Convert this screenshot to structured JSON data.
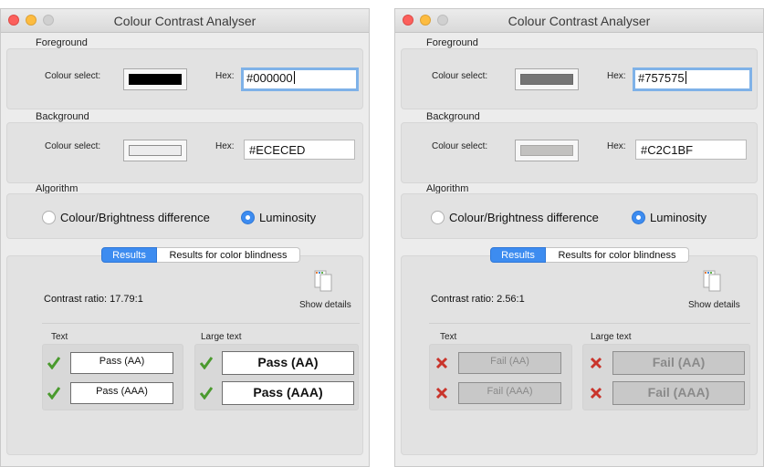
{
  "left": {
    "title": "Colour Contrast Analyser",
    "foreground": {
      "label": "Foreground",
      "colour_select_label": "Colour select:",
      "hex_label": "Hex:",
      "hex_value": "#000000",
      "swatch_color": "#000000"
    },
    "background": {
      "label": "Background",
      "colour_select_label": "Colour select:",
      "hex_label": "Hex:",
      "hex_value": "#ECECED",
      "swatch_color": "#ECECED"
    },
    "algorithm": {
      "label": "Algorithm",
      "option1": "Colour/Brightness difference",
      "option2": "Luminosity",
      "selected": "Luminosity"
    },
    "tabs": {
      "results": "Results",
      "color_blindness": "Results for color blindness"
    },
    "contrast_ratio": "Contrast ratio: 17.79:1",
    "show_details": "Show details",
    "text": {
      "label": "Text",
      "aa": "Pass (AA)",
      "aaa": "Pass (AAA)"
    },
    "large_text": {
      "label": "Large text",
      "aa": "Pass (AA)",
      "aaa": "Pass (AAA)"
    },
    "status": "pass"
  },
  "right": {
    "title": "Colour Contrast Analyser",
    "foreground": {
      "label": "Foreground",
      "colour_select_label": "Colour select:",
      "hex_label": "Hex:",
      "hex_value": "#757575",
      "swatch_color": "#757575"
    },
    "background": {
      "label": "Background",
      "colour_select_label": "Colour select:",
      "hex_label": "Hex:",
      "hex_value": "#C2C1BF",
      "swatch_color": "#C2C1BF"
    },
    "algorithm": {
      "label": "Algorithm",
      "option1": "Colour/Brightness difference",
      "option2": "Luminosity",
      "selected": "Luminosity"
    },
    "tabs": {
      "results": "Results",
      "color_blindness": "Results for color blindness"
    },
    "contrast_ratio": "Contrast ratio: 2.56:1",
    "show_details": "Show details",
    "text": {
      "label": "Text",
      "aa": "Fail (AA)",
      "aaa": "Fail (AAA)"
    },
    "large_text": {
      "label": "Large text",
      "aa": "Fail (AA)",
      "aaa": "Fail (AAA)"
    },
    "status": "fail"
  },
  "colors": {
    "accent": "#3D8CF0",
    "pass_check": "#4A9A2E",
    "fail_x": "#C9342B"
  }
}
